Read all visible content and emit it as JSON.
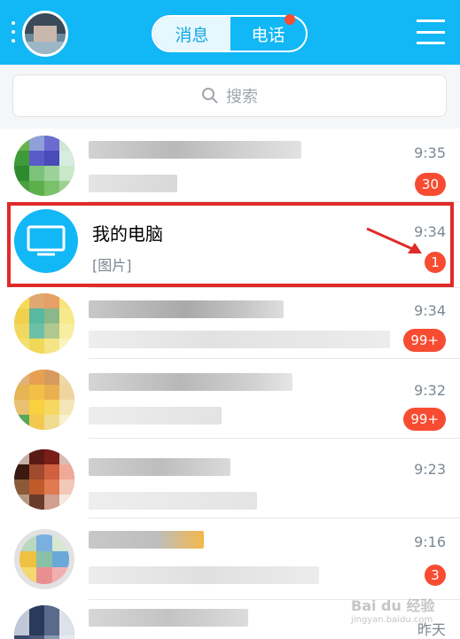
{
  "header": {
    "tab_messages": "消息",
    "tab_calls": "电话",
    "accent": "#12b7f5"
  },
  "search": {
    "placeholder": "搜索"
  },
  "chats": [
    {
      "time": "9:35",
      "badge": "30"
    },
    {
      "name": "我的电脑",
      "preview": "[图片]",
      "time": "9:34",
      "badge": "1"
    },
    {
      "time": "9:34",
      "badge": "99+"
    },
    {
      "time": "9:32",
      "badge": "99+"
    },
    {
      "time": "9:23"
    },
    {
      "time": "9:16",
      "badge": "3"
    },
    {
      "time": "昨天"
    }
  ],
  "watermark": {
    "text": "Bai du 经验",
    "sub": "jingyan.baidu.com"
  },
  "icons": {
    "search": "search-icon",
    "monitor": "monitor-icon",
    "menu": "menu-icon"
  }
}
